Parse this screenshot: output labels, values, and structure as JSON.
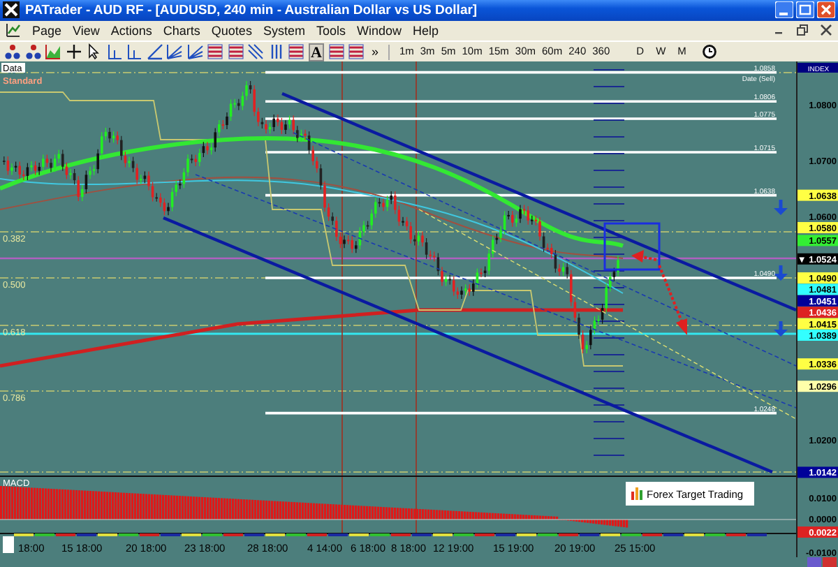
{
  "window": {
    "title": "PATrader - AUD RF - [AUDUSD, 240 min - Australian Dollar vs US Dollar]"
  },
  "menu": [
    "Page",
    "View",
    "Actions",
    "Charts",
    "Quotes",
    "System",
    "Tools",
    "Window",
    "Help"
  ],
  "toolbar": {
    "text_tool": "A",
    "overflow": "»",
    "timeframes": [
      "1m",
      "3m",
      "5m",
      "10m",
      "15m",
      "30m",
      "60m",
      "240",
      "360"
    ],
    "periods": [
      "D",
      "W",
      "M"
    ]
  },
  "chart": {
    "panel_label": "Data",
    "indicator_label": "Standard",
    "fib_ratios": [
      "0.382",
      "0.500",
      "0.618",
      "0.786"
    ],
    "fib_prices": [
      {
        "price": "1.0858",
        "note": "Date (Sell)"
      },
      {
        "price": "1.0806"
      },
      {
        "price": "1.0775"
      },
      {
        "price": "1.0715"
      },
      {
        "price": "1.0638"
      },
      {
        "price": "1.0490"
      },
      {
        "price": "1.0248"
      }
    ],
    "price_axis": {
      "title": "INDEX",
      "labels": [
        "1.0800",
        "1.0700",
        "1.0600",
        "1.0200"
      ]
    },
    "price_tags": [
      {
        "text": "1.0638",
        "color": "#ffff44"
      },
      {
        "text": "1.0580",
        "color": "#ffff44"
      },
      {
        "text": "1.0557",
        "color": "#33ee33"
      },
      {
        "text": "▼ 1.0524",
        "color": "#000000"
      },
      {
        "text": "1.0490",
        "color": "#ffff44"
      },
      {
        "text": "1.0481",
        "color": "#33ffff"
      },
      {
        "text": "1.0451",
        "color": "#000099"
      },
      {
        "text": "1.0436",
        "color": "#dd2222"
      },
      {
        "text": "1.0415",
        "color": "#ffff44"
      },
      {
        "text": "1.0389",
        "color": "#33ffff"
      },
      {
        "text": "1.0336",
        "color": "#ffff44"
      },
      {
        "text": "1.0296",
        "color": "#ffffaa"
      },
      {
        "text": "1.0142",
        "color": "#000099"
      }
    ],
    "macd": {
      "label": "MACD",
      "axis_labels": [
        "0.0100",
        "0.0000",
        "-0.0100"
      ],
      "tags": [
        {
          "text": "0.0022",
          "color": "#dd2222"
        }
      ]
    },
    "logo": "Forex Target Trading",
    "time_axis": [
      "18:00",
      "15 18:00",
      "20 18:00",
      "23 18:00",
      "28 18:00",
      "4 14:00",
      "6 18:00",
      "8 18:00",
      "12 19:00",
      "15 19:00",
      "20 19:00",
      "25 15:00"
    ]
  }
}
